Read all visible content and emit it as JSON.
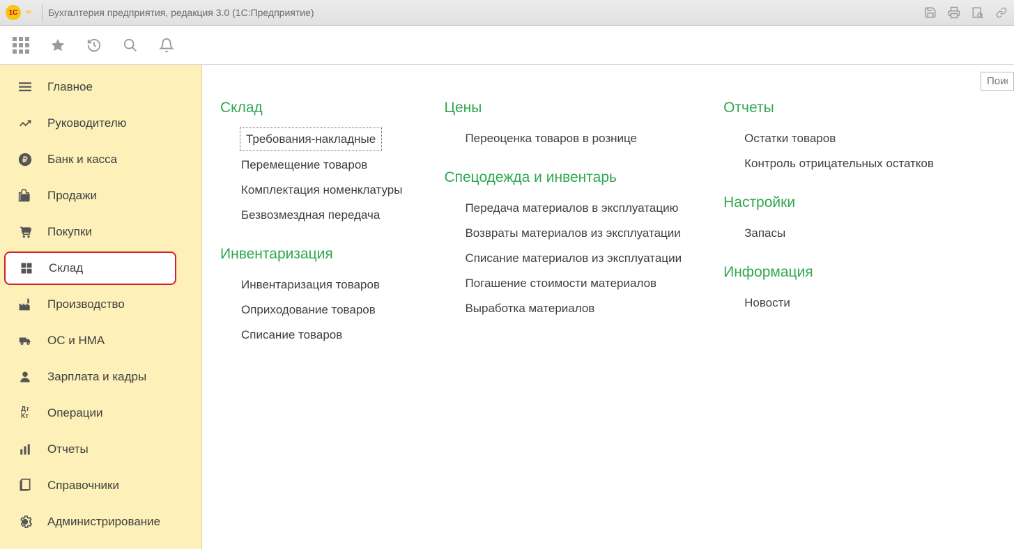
{
  "titlebar": {
    "title": "Бухгалтерия предприятия, редакция 3.0  (1С:Предприятие)",
    "logo": "1С"
  },
  "search": {
    "placeholder": "Поис"
  },
  "sidebar": {
    "items": [
      {
        "label": "Главное",
        "icon": "menu-icon"
      },
      {
        "label": "Руководителю",
        "icon": "chart-icon"
      },
      {
        "label": "Банк и касса",
        "icon": "ruble-icon"
      },
      {
        "label": "Продажи",
        "icon": "bag-icon"
      },
      {
        "label": "Покупки",
        "icon": "cart-icon"
      },
      {
        "label": "Склад",
        "icon": "boxes-icon"
      },
      {
        "label": "Производство",
        "icon": "factory-icon"
      },
      {
        "label": "ОС и НМА",
        "icon": "truck-icon"
      },
      {
        "label": "Зарплата и кадры",
        "icon": "person-icon"
      },
      {
        "label": "Операции",
        "icon": "dtkt-icon"
      },
      {
        "label": "Отчеты",
        "icon": "bars-icon"
      },
      {
        "label": "Справочники",
        "icon": "books-icon"
      },
      {
        "label": "Администрирование",
        "icon": "gear-icon"
      }
    ],
    "active_index": 5
  },
  "columns": [
    {
      "sections": [
        {
          "title": "Склад",
          "links": [
            "Требования-накладные",
            "Перемещение товаров",
            "Комплектация номенклатуры",
            "Безвозмездная передача"
          ],
          "selected": 0
        },
        {
          "title": "Инвентаризация",
          "links": [
            "Инвентаризация товаров",
            "Оприходование товаров",
            "Списание товаров"
          ]
        }
      ]
    },
    {
      "sections": [
        {
          "title": "Цены",
          "links": [
            "Переоценка товаров в рознице"
          ]
        },
        {
          "title": "Спецодежда и инвентарь",
          "links": [
            "Передача материалов в эксплуатацию",
            "Возвраты материалов из эксплуатации",
            "Списание материалов из эксплуатации",
            "Погашение стоимости материалов",
            "Выработка материалов"
          ]
        }
      ]
    },
    {
      "sections": [
        {
          "title": "Отчеты",
          "links": [
            "Остатки товаров",
            "Контроль отрицательных остатков"
          ]
        },
        {
          "title": "Настройки",
          "links": [
            "Запасы"
          ]
        },
        {
          "title": "Информация",
          "links": [
            "Новости"
          ]
        }
      ]
    }
  ]
}
